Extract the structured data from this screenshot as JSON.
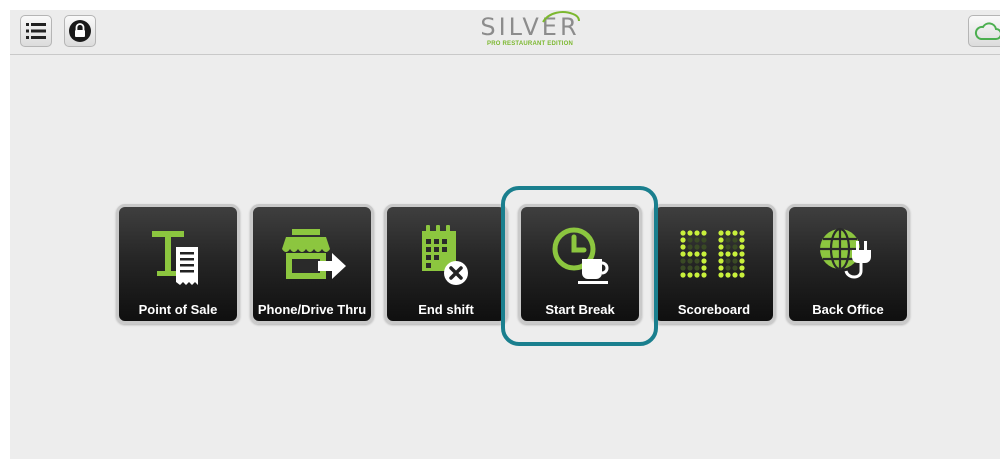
{
  "header": {
    "logo_text": "SILVER",
    "logo_subtitle": "PRO RESTAURANT EDITION",
    "buttons": [
      {
        "icon": "list-icon"
      },
      {
        "icon": "lock-icon"
      },
      {
        "icon": "cloud-icon"
      }
    ]
  },
  "tiles": [
    {
      "label": "Point of Sale",
      "icon": "pos-receipt-icon"
    },
    {
      "label": "Phone/Drive Thru",
      "icon": "storefront-arrow-icon"
    },
    {
      "label": "End shift",
      "icon": "calendar-close-icon"
    },
    {
      "label": "Start Break",
      "icon": "clock-coffee-icon"
    },
    {
      "label": "Scoreboard",
      "icon": "scoreboard-icon"
    },
    {
      "label": "Back Office",
      "icon": "globe-plug-icon"
    }
  ],
  "colors": {
    "accent_green": "#8cc63f",
    "scoreboard_green": "#c8f03c",
    "highlight": "#1a7f8e",
    "cloud": "#4caf50"
  }
}
